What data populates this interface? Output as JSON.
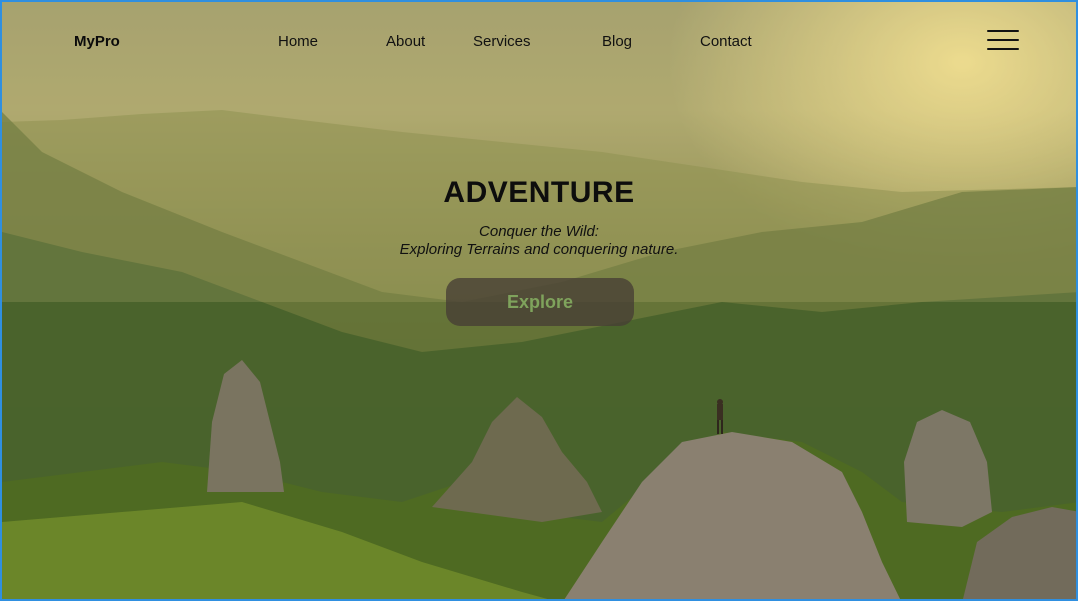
{
  "nav": {
    "brand": "MyPro",
    "links": [
      "Home",
      "About",
      "Services",
      "Blog",
      "Contact"
    ],
    "menu_icon": "hamburger-menu-icon"
  },
  "hero": {
    "title": "ADVENTURE",
    "subtitle_line1": "Conquer the Wild:",
    "subtitle_line2": "Exploring Terrains and conquering nature.",
    "cta_label": "Explore"
  },
  "colors": {
    "cta_text": "#7fa35c",
    "cta_bg": "#463e34",
    "frame_border": "#2f8fe0"
  }
}
